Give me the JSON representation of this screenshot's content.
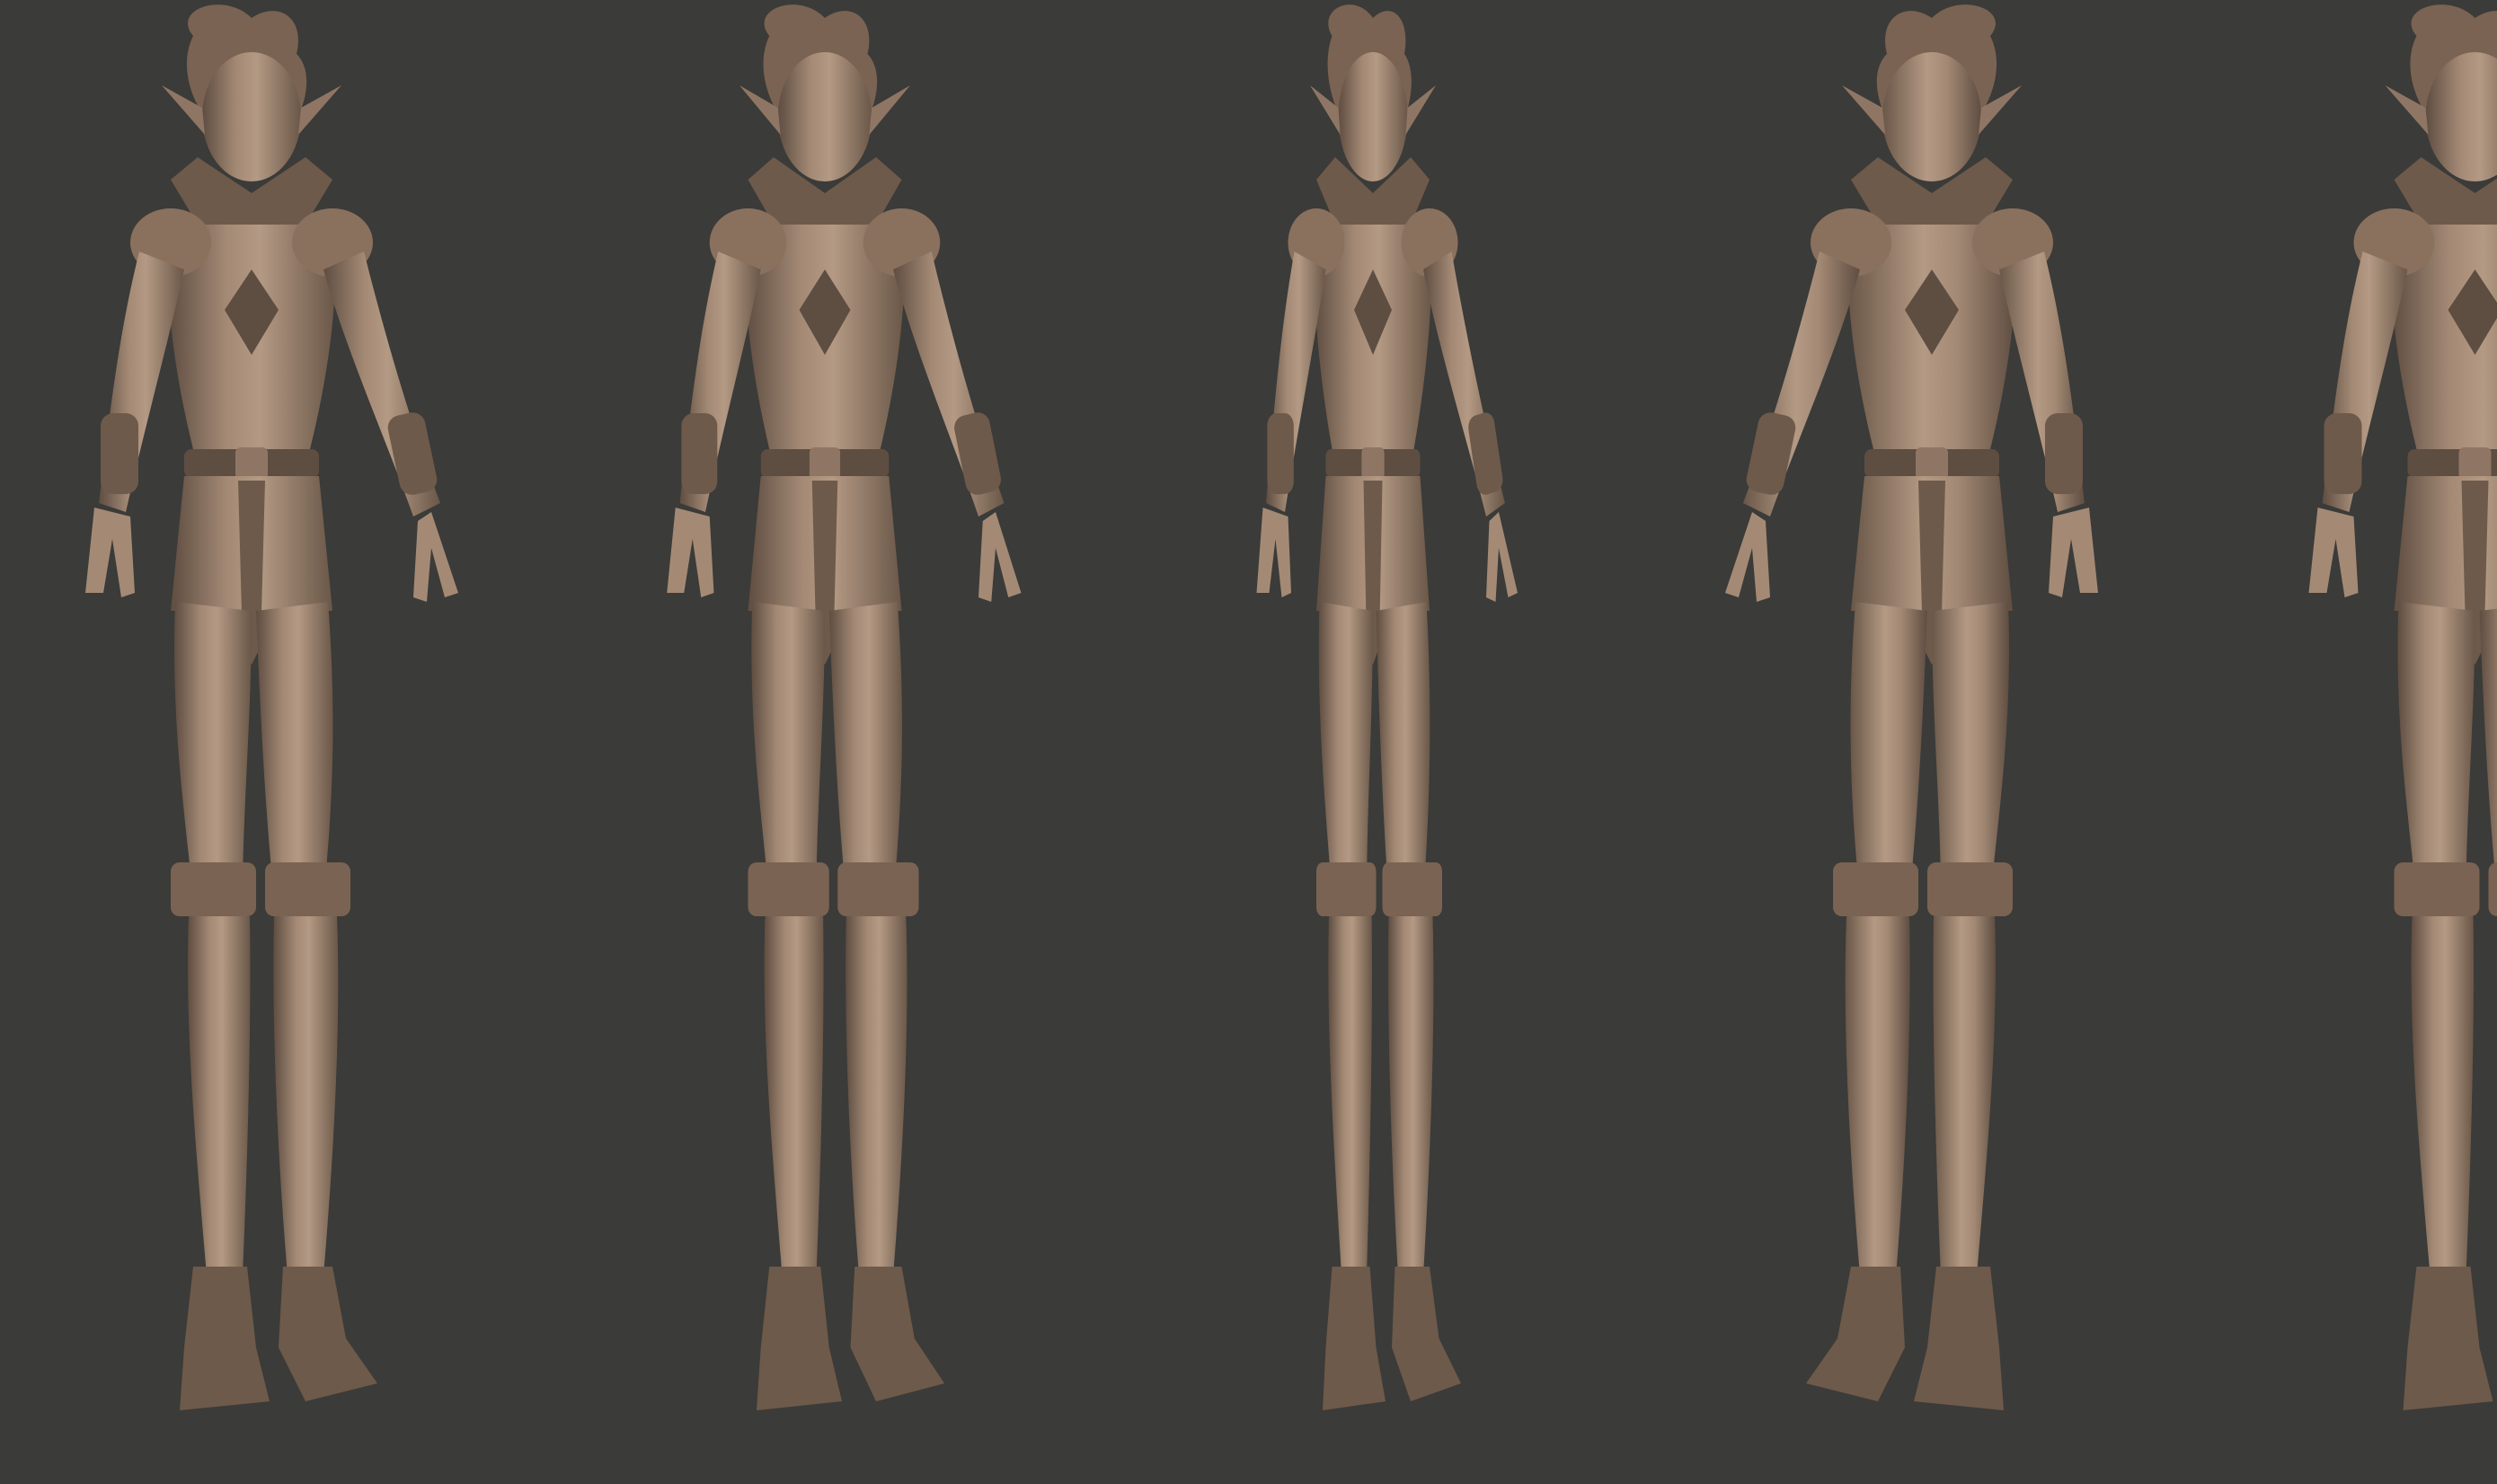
{
  "colors": {
    "background": "#3b3b39",
    "clay_light": "#b49a84",
    "clay_mid": "#8f7664",
    "clay_dark": "#5e4d41",
    "clay_shadow": "#463a32"
  },
  "views": [
    {
      "view": "front"
    },
    {
      "view": "three-quarter-front"
    },
    {
      "view": "side"
    },
    {
      "view": "three-quarter-back"
    },
    {
      "view": "back-cropped"
    }
  ]
}
